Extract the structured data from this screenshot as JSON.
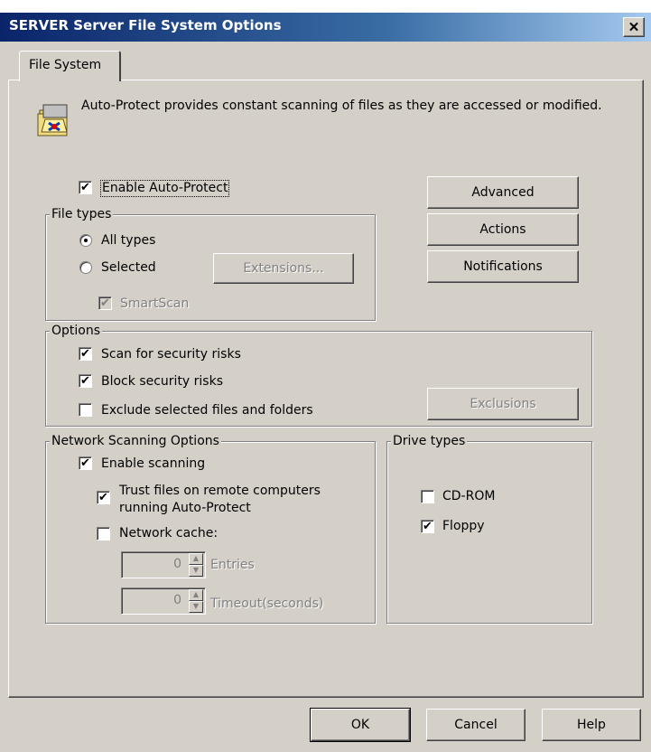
{
  "window": {
    "title": "SERVER Server File System Options",
    "close_symbol": "✕"
  },
  "tabs": [
    {
      "label": "File System",
      "active": true
    }
  ],
  "intro": {
    "icon": "folder-shield-icon",
    "text": "Auto-Protect provides constant scanning of files as they are accessed or modified."
  },
  "enable_auto_protect": {
    "label": "Enable Auto-Protect",
    "checked": true
  },
  "side_buttons": {
    "advanced": "Advanced",
    "actions": "Actions",
    "notifications": "Notifications"
  },
  "file_types": {
    "legend": "File types",
    "all_types": {
      "label": "All types",
      "selected": true
    },
    "selected": {
      "label": "Selected",
      "selected": false
    },
    "extensions_button": "Extensions...",
    "smartscan": {
      "label": "SmartScan",
      "checked": true,
      "disabled": true
    }
  },
  "options": {
    "legend": "Options",
    "scan_security_risks": {
      "label": "Scan for security risks",
      "checked": true
    },
    "block_security_risks": {
      "label": "Block security risks",
      "checked": true
    },
    "exclude_selected": {
      "label": "Exclude selected files and folders",
      "checked": false
    },
    "exclusions_button": "Exclusions"
  },
  "network": {
    "legend": "Network Scanning Options",
    "enable_scanning": {
      "label": "Enable scanning",
      "checked": true
    },
    "trust_files": {
      "label_line1": "Trust files on remote computers",
      "label_line2": "running Auto-Protect",
      "checked": true
    },
    "network_cache": {
      "label": "Network cache:",
      "checked": false
    },
    "entries": {
      "value": "0",
      "label": "Entries"
    },
    "timeout": {
      "value": "0",
      "label": "Timeout(seconds)"
    }
  },
  "drive_types": {
    "legend": "Drive types",
    "cdrom": {
      "label": "CD-ROM",
      "checked": false
    },
    "floppy": {
      "label": "Floppy",
      "checked": true
    }
  },
  "footer": {
    "ok": "OK",
    "cancel": "Cancel",
    "help": "Help"
  },
  "check_mark": "✔"
}
